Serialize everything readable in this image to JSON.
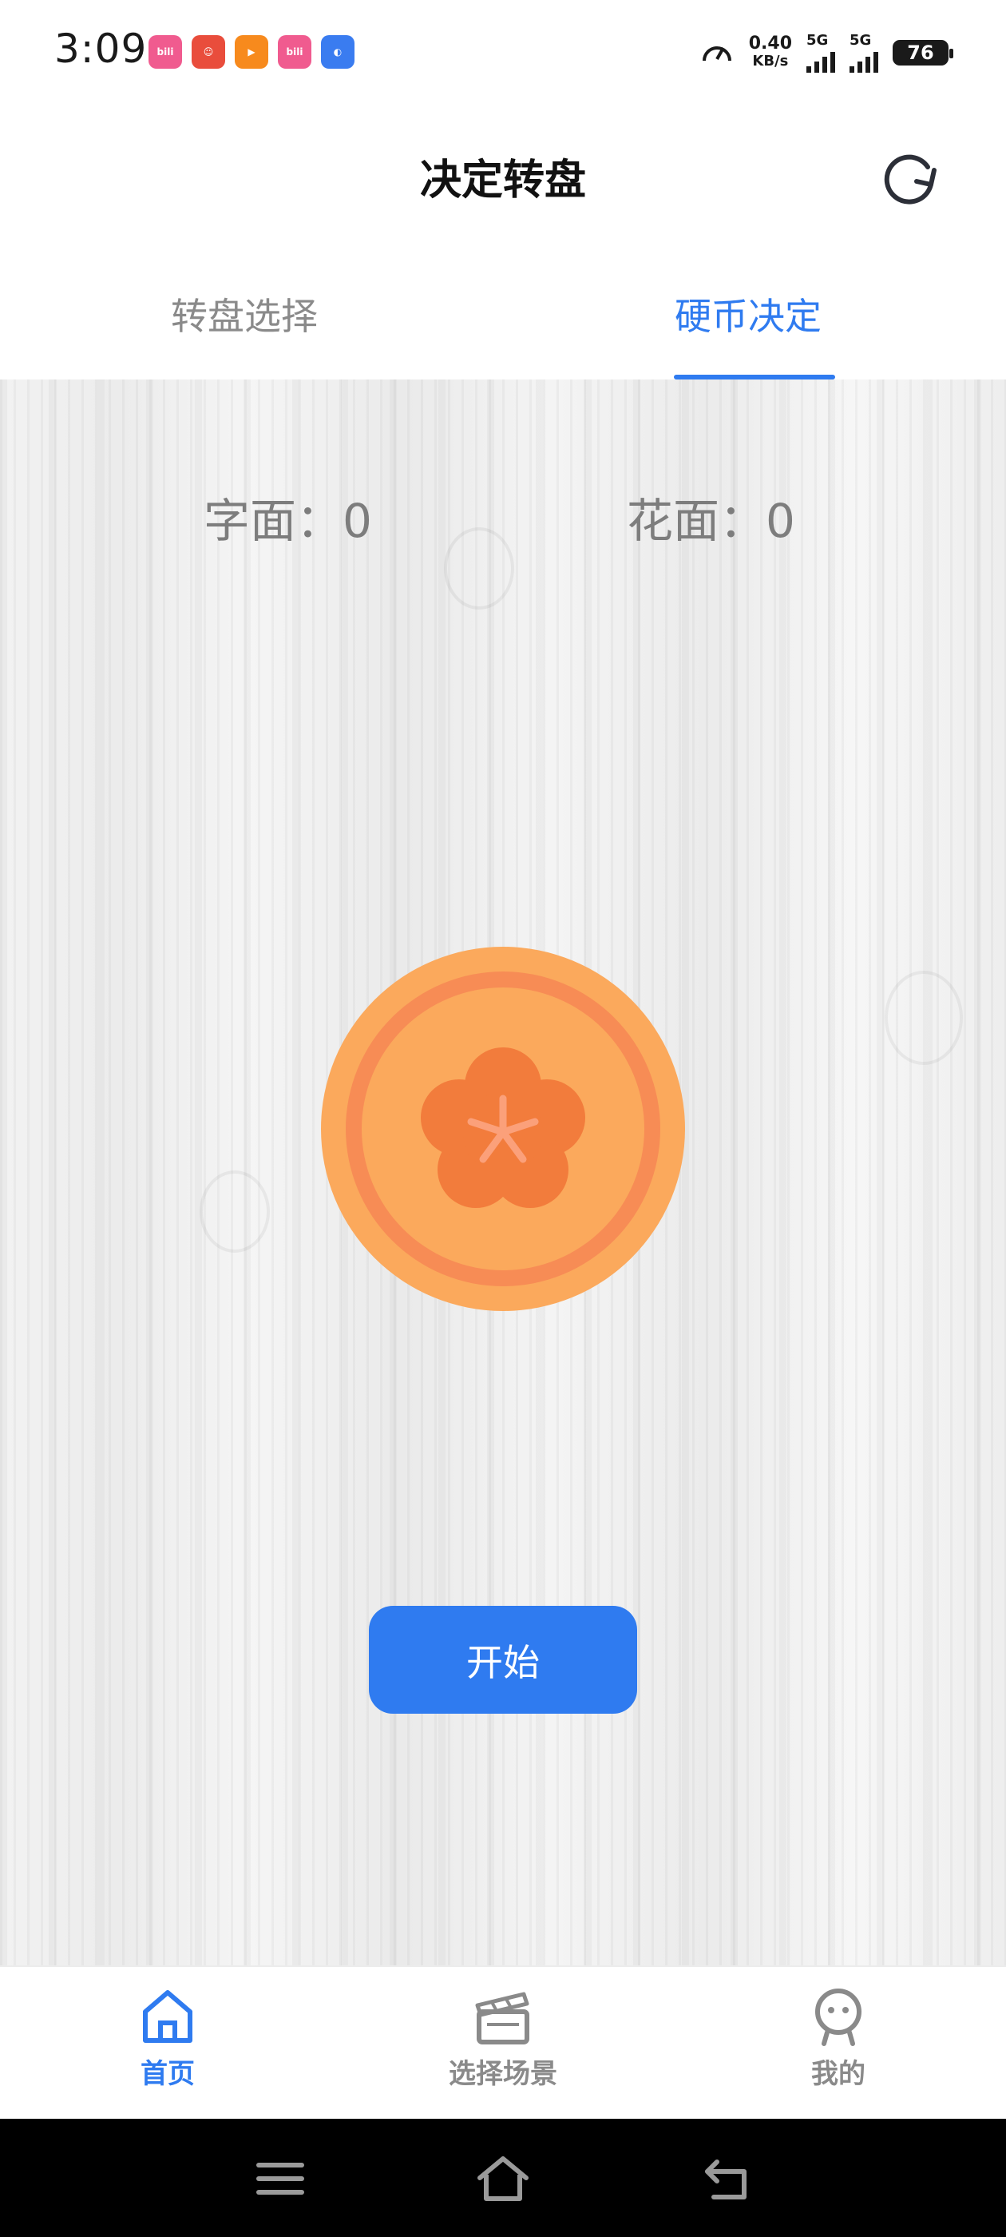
{
  "status_bar": {
    "time": "3:09",
    "app_icons": [
      "bilibili-icon",
      "clown-app-icon",
      "kuaishou-icon",
      "bilibili-icon",
      "browser-icon"
    ],
    "speed_value": "0.40",
    "speed_unit": "KB/s",
    "network_1": "5G",
    "network_2": "5G",
    "battery": "76"
  },
  "header": {
    "title": "决定转盘"
  },
  "tabs": [
    {
      "label": "转盘选择",
      "active": false
    },
    {
      "label": "硬币决定",
      "active": true
    }
  ],
  "scores": {
    "char_side": "字面：0",
    "flower_side": "花面：0"
  },
  "start_button_label": "开始",
  "bottom_nav": [
    {
      "label": "首页",
      "icon": "home-icon",
      "active": true
    },
    {
      "label": "选择场景",
      "icon": "clapperboard-icon",
      "active": false
    },
    {
      "label": "我的",
      "icon": "profile-icon",
      "active": false
    }
  ],
  "colors": {
    "accent": "#2f7bf0",
    "coin_outer": "#fba95c",
    "coin_ring": "#f78c55",
    "coin_flower": "#f27c3c"
  }
}
